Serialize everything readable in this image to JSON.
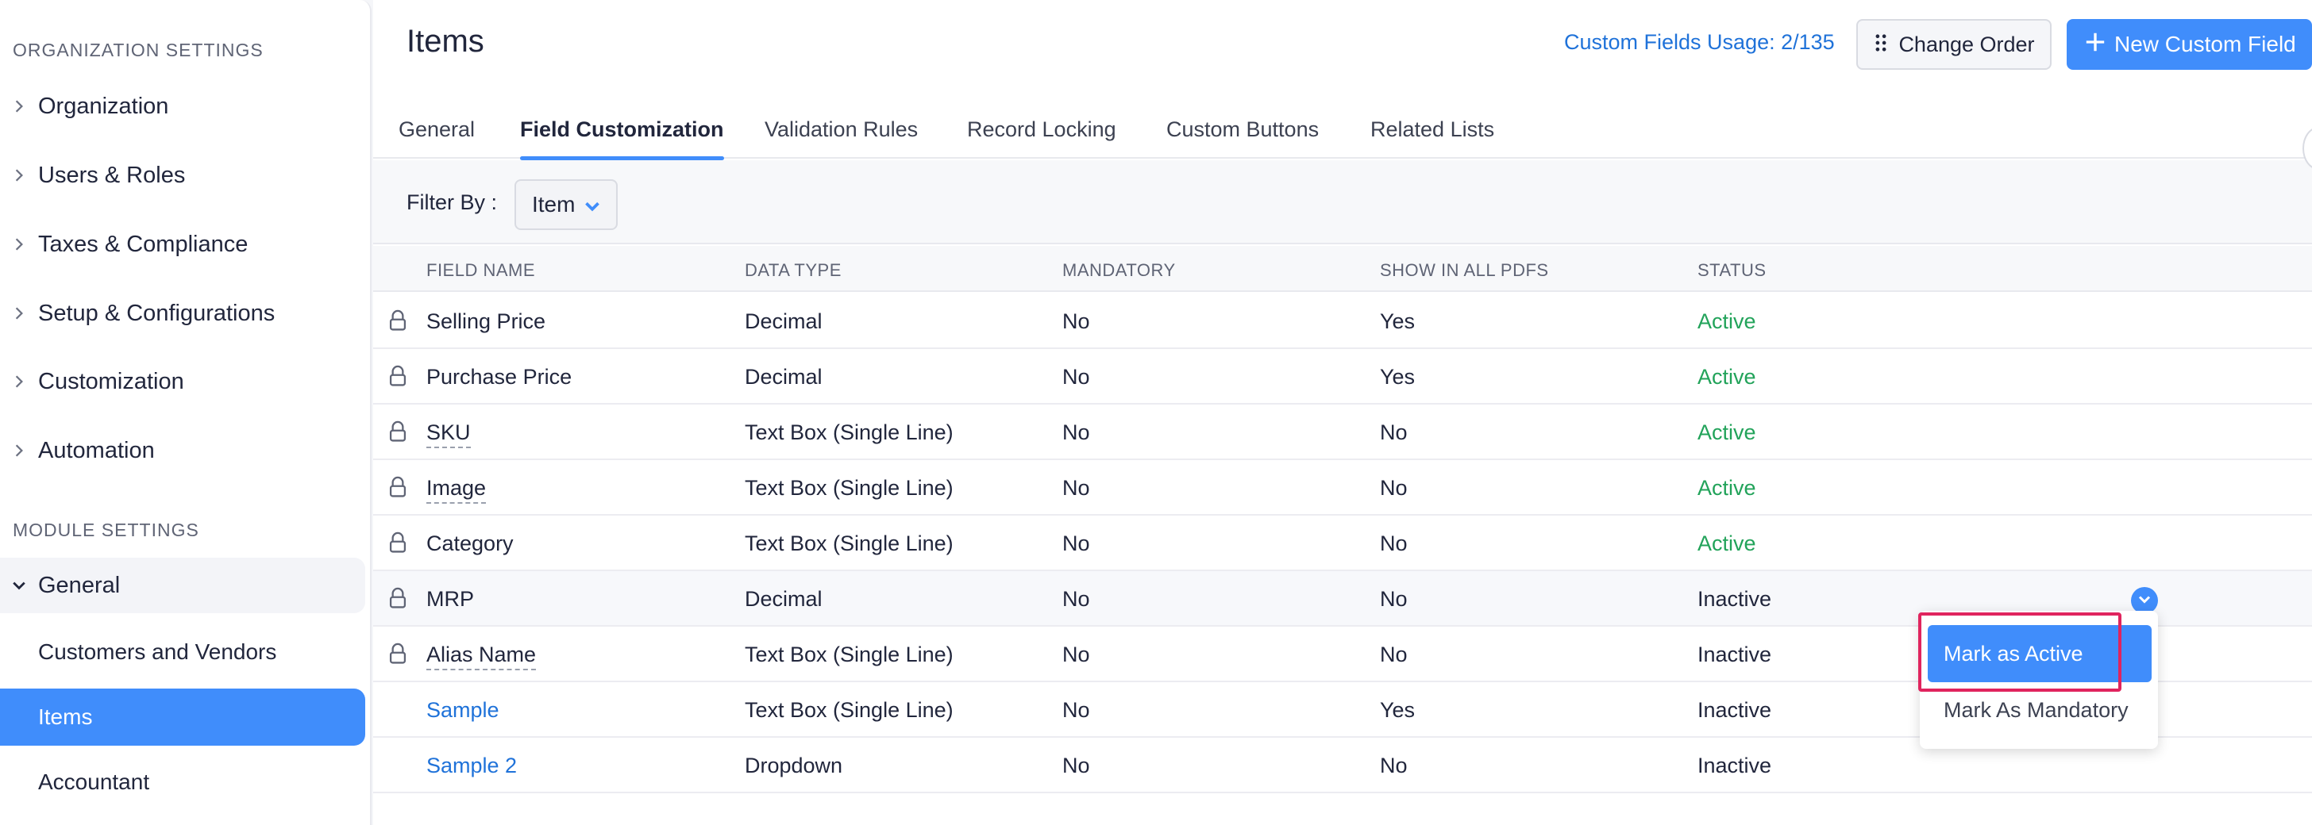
{
  "sidebar": {
    "org_title": "ORGANIZATION SETTINGS",
    "org_items": [
      {
        "label": "Organization"
      },
      {
        "label": "Users & Roles"
      },
      {
        "label": "Taxes & Compliance"
      },
      {
        "label": "Setup & Configurations"
      },
      {
        "label": "Customization"
      },
      {
        "label": "Automation"
      }
    ],
    "module_title": "MODULE SETTINGS",
    "module_group": "General",
    "module_sub_items": [
      {
        "label": "Customers and Vendors"
      },
      {
        "label": "Items"
      },
      {
        "label": "Accountant"
      }
    ]
  },
  "header": {
    "title": "Items",
    "usage_link": "Custom Fields Usage: 2/135",
    "change_order_label": "Change Order",
    "new_field_label": "New Custom Field"
  },
  "tabs": [
    {
      "label": "General"
    },
    {
      "label": "Field Customization"
    },
    {
      "label": "Validation Rules"
    },
    {
      "label": "Record Locking"
    },
    {
      "label": "Custom Buttons"
    },
    {
      "label": "Related Lists"
    }
  ],
  "active_tab": "Field Customization",
  "filter": {
    "label": "Filter By :",
    "value": "Item"
  },
  "table": {
    "columns": [
      "FIELD NAME",
      "DATA TYPE",
      "MANDATORY",
      "SHOW IN ALL PDFS",
      "STATUS"
    ],
    "rows": [
      {
        "name": "Selling Price",
        "type": "Decimal",
        "mandatory": "No",
        "pdf": "Yes",
        "status": "Active"
      },
      {
        "name": "Purchase Price",
        "type": "Decimal",
        "mandatory": "No",
        "pdf": "Yes",
        "status": "Active"
      },
      {
        "name": "SKU",
        "type": "Text Box (Single Line)",
        "mandatory": "No",
        "pdf": "No",
        "status": "Active"
      },
      {
        "name": "Image",
        "type": "Text Box (Single Line)",
        "mandatory": "No",
        "pdf": "No",
        "status": "Active"
      },
      {
        "name": "Category",
        "type": "Text Box (Single Line)",
        "mandatory": "No",
        "pdf": "No",
        "status": "Active"
      },
      {
        "name": "MRP",
        "type": "Decimal",
        "mandatory": "No",
        "pdf": "No",
        "status": "Inactive"
      },
      {
        "name": "Alias Name",
        "type": "Text Box (Single Line)",
        "mandatory": "No",
        "pdf": "No",
        "status": "Inactive"
      },
      {
        "name": "Sample",
        "type": "Text Box (Single Line)",
        "mandatory": "No",
        "pdf": "Yes",
        "status": "Inactive"
      },
      {
        "name": "Sample 2",
        "type": "Dropdown",
        "mandatory": "No",
        "pdf": "No",
        "status": "Inactive"
      }
    ]
  },
  "row_menu": {
    "mark_active_label": "Mark as Active",
    "mark_mandatory_label": "Mark As Mandatory"
  },
  "colors": {
    "accent": "#408dfb",
    "link": "#1f72d9",
    "active_status": "#22a35a",
    "highlight_box": "#e0245e"
  },
  "icons": [
    "chevron-right-icon",
    "chevron-down-icon",
    "drag-dots-icon",
    "plus-icon",
    "lock-icon"
  ]
}
